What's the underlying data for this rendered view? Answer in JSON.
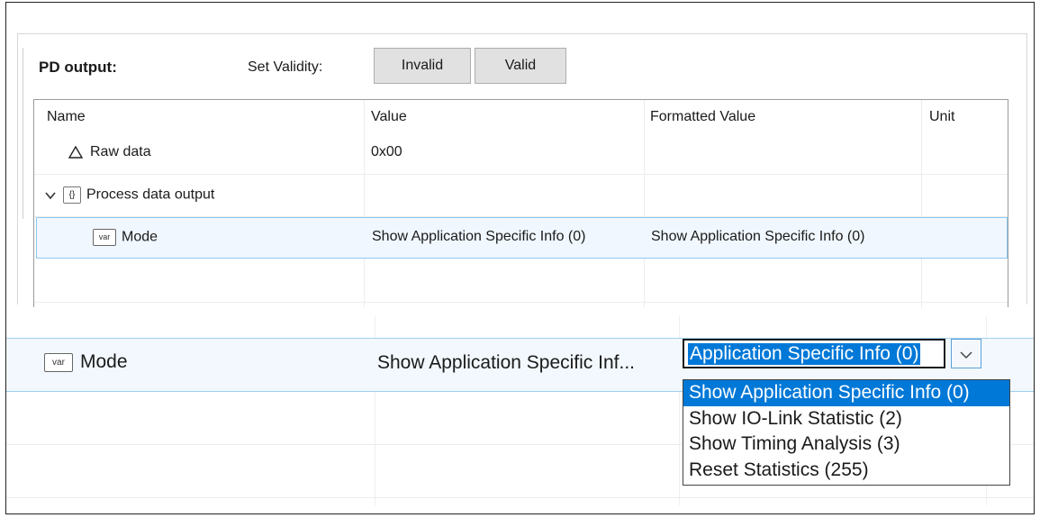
{
  "header": {
    "pd_output_label": "PD output",
    "pd_output_colon": ":",
    "set_validity_label": "Set Validity:",
    "invalid_button": "Invalid",
    "valid_button": "Valid"
  },
  "table": {
    "columns": [
      "Name",
      "Value",
      "Formatted Value",
      "Unit"
    ],
    "rows": [
      {
        "name": "Raw data",
        "icon": "triangle-icon",
        "value": "0x00",
        "formatted": "",
        "unit": ""
      },
      {
        "name": "Process data output",
        "icon": "object-icon",
        "value": "",
        "formatted": "",
        "unit": ""
      },
      {
        "name": "Mode",
        "icon": "var-icon",
        "value": "Show Application Specific Info (0)",
        "formatted": "Show Application Specific Info (0)",
        "unit": ""
      }
    ],
    "icon_text": {
      "var": "var",
      "object": "{}"
    }
  },
  "zoom": {
    "mode_label": "Mode",
    "value_truncated": "Show Application Specific Inf...",
    "combo_text": "Application Specific Info (0)",
    "options": [
      "Show Application Specific Info (0)",
      "Show IO-Link Statistic (2)",
      "Show Timing Analysis (3)",
      "Reset Statistics (255)"
    ],
    "selected_option_index": 0
  },
  "colors": {
    "selection_blue": "#0078d7",
    "row_highlight": "#f0f7ff",
    "row_border": "#8ec8f0",
    "button_bg": "#e1e1e1"
  }
}
